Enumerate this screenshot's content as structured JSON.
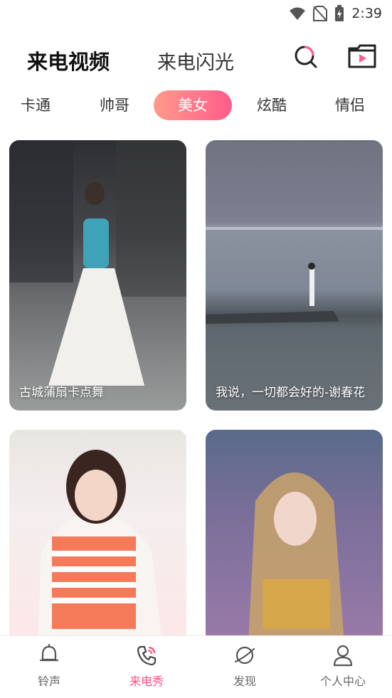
{
  "status_bar": {
    "time": "2:39",
    "icons": [
      "wifi-icon",
      "no-sim-icon",
      "battery-charging-icon"
    ]
  },
  "header": {
    "tabs": [
      {
        "label": "来电视频",
        "active": true
      },
      {
        "label": "来电闪光",
        "active": false
      }
    ],
    "icons": [
      "search-icon",
      "video-folder-icon"
    ]
  },
  "categories": [
    {
      "label": "卡通",
      "active": false
    },
    {
      "label": "帅哥",
      "active": false
    },
    {
      "label": "美女",
      "active": true
    },
    {
      "label": "炫酷",
      "active": false
    },
    {
      "label": "情侣",
      "active": false
    }
  ],
  "cards": [
    {
      "title": "古城蒲扇卡点舞"
    },
    {
      "title": "我说，一切都会好的-谢春花"
    },
    {
      "title": ""
    },
    {
      "title": ""
    }
  ],
  "bottom_nav": [
    {
      "label": "铃声",
      "icon": "bell-icon",
      "active": false
    },
    {
      "label": "来电秀",
      "icon": "phone-call-icon",
      "active": true
    },
    {
      "label": "发现",
      "icon": "planet-icon",
      "active": false
    },
    {
      "label": "个人中心",
      "icon": "user-icon",
      "active": false
    }
  ],
  "colors": {
    "accent": "#ff4f7e",
    "chip_gradient_start": "#ff9a8b",
    "chip_gradient_end": "#ff5c8a"
  }
}
